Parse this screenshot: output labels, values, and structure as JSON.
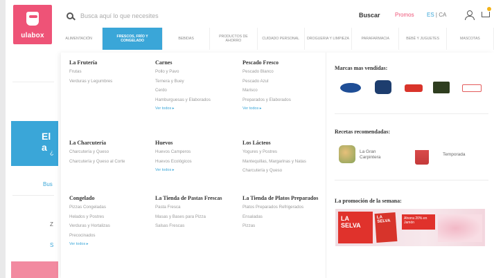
{
  "header": {
    "logo_text": "ulabox",
    "search_placeholder": "Busca aquí lo que necesites",
    "search_button": "Buscar",
    "promo_link": "Promos",
    "lang_es": "ES",
    "lang_sep": "|",
    "lang_ca": "CA"
  },
  "nav": {
    "items": [
      "Alimentación",
      "Frescos, Frío y Congelado",
      "Bebidas",
      "Productos de Ahorro",
      "Cuidado Personal",
      "Drogueria y Limpieza",
      "Parafarmacia",
      "Bebé y Juguetes",
      "Mascotas"
    ]
  },
  "behind": {
    "banner_title": "El a",
    "banner_sub": "¿",
    "link1": "Bus",
    "link2": "Z",
    "link3": "S"
  },
  "menu": {
    "columns": [
      {
        "title": "La Frutería",
        "items": [
          "Frutas",
          "Verduras y Legumbres"
        ],
        "more": ""
      },
      {
        "title": "Carnes",
        "items": [
          "Pollo y Pavo",
          "Ternera y Buey",
          "Cerdo",
          "Hamburguesas y Elaborados"
        ],
        "more": "Ver todos"
      },
      {
        "title": "Pescado Fresco",
        "items": [
          "Pescado Blanco",
          "Pescado Azul",
          "Marisco",
          "Preparados y Elaborados"
        ],
        "more": "Ver todos"
      },
      {
        "title": "La Charcutería",
        "items": [
          "Charcutería y Queso",
          "Charcutería y Queso al Corte"
        ],
        "more": ""
      },
      {
        "title": "Huevos",
        "items": [
          "Huevos Camperos",
          "Huevos Ecológicos"
        ],
        "more": "Ver todos"
      },
      {
        "title": "Los Lácteos",
        "items": [
          "Yogures y Postres",
          "Mantequillas, Margarinas y Natas",
          "Charcutería y Queso"
        ],
        "more": ""
      },
      {
        "title": "Congelado",
        "items": [
          "Pizzas Congeladas",
          "Helados y Postres",
          "Verduras y Hortalizas",
          "Precocinados"
        ],
        "more": "Ver todos"
      },
      {
        "title": "La Tienda de Pastas Frescas",
        "items": [
          "Pasta Fresca",
          "Masas y Bases para Pizza",
          "Salsas Frescas"
        ],
        "more": ""
      },
      {
        "title": "La Tienda de Platos Preparados",
        "items": [
          "Platos Preparados Refrigerados",
          "Ensaladas",
          "Pizzas"
        ],
        "more": ""
      }
    ]
  },
  "right": {
    "brands_title": "Marcas mas vendidas:",
    "recs_title": "Recetas recomendadas:",
    "rec1": "La Gran Carpintera",
    "rec2": "Temporada",
    "promo_title": "La promoción de la semana:",
    "promo_brand": "LA SELVA",
    "promo_pack": "LA SELVA",
    "promo_tag": "Ahorra 20% en Jamón"
  },
  "colors": {
    "accent_blue": "#3aa6d8",
    "brand_pink": "#ee5377"
  }
}
